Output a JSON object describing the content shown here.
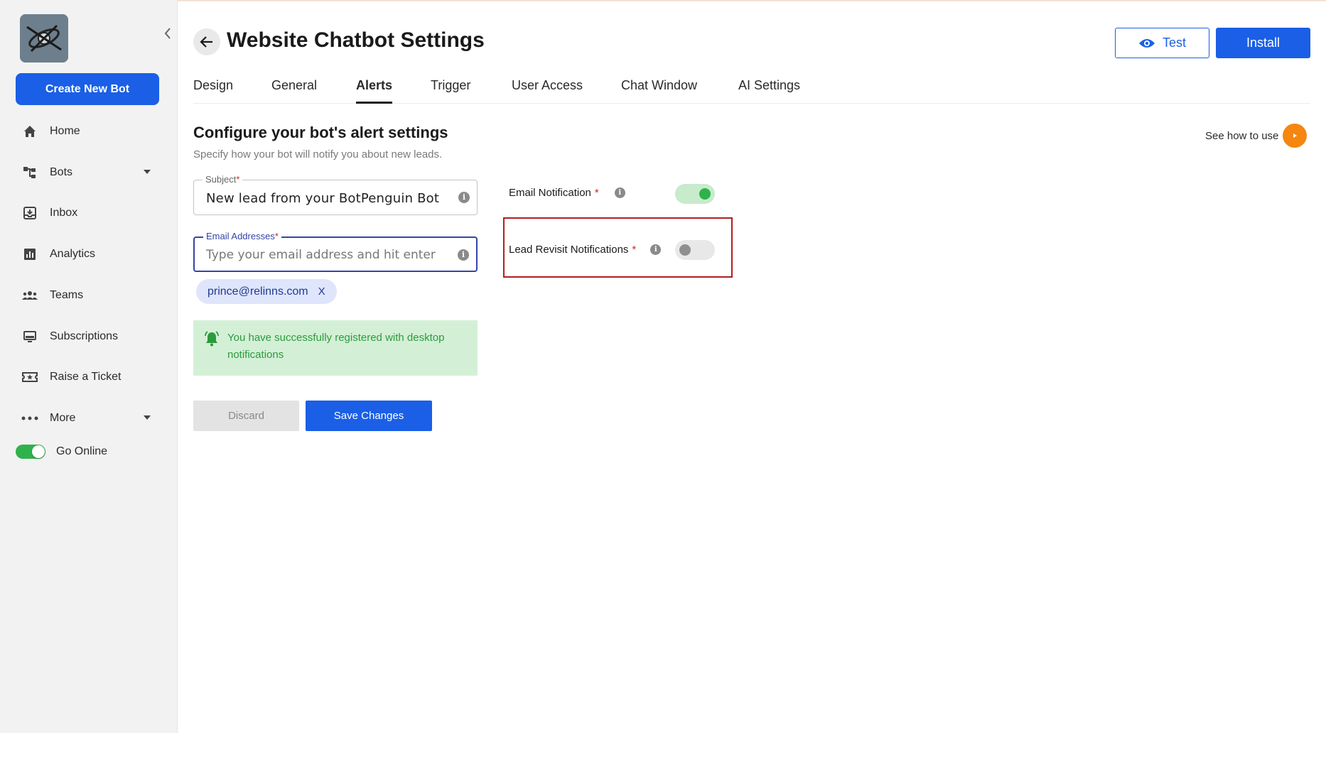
{
  "sidebar": {
    "create_label": "Create New Bot",
    "items": [
      {
        "label": "Home",
        "icon": "home-icon"
      },
      {
        "label": "Bots",
        "icon": "bots-icon",
        "has_caret": true
      },
      {
        "label": "Inbox",
        "icon": "inbox-icon"
      },
      {
        "label": "Analytics",
        "icon": "analytics-icon"
      },
      {
        "label": "Teams",
        "icon": "teams-icon"
      },
      {
        "label": "Subscriptions",
        "icon": "subscriptions-icon"
      },
      {
        "label": "Raise a Ticket",
        "icon": "ticket-icon"
      },
      {
        "label": "More",
        "icon": "more-icon",
        "has_caret": true
      }
    ],
    "go_online_label": "Go Online",
    "go_online_enabled": true
  },
  "header": {
    "title": "Website Chatbot Settings",
    "test_label": "Test",
    "install_label": "Install"
  },
  "tabs": [
    {
      "label": "Design",
      "active": false
    },
    {
      "label": "General",
      "active": false
    },
    {
      "label": "Alerts",
      "active": true
    },
    {
      "label": "Trigger",
      "active": false
    },
    {
      "label": "User Access",
      "active": false
    },
    {
      "label": "Chat Window",
      "active": false
    },
    {
      "label": "AI Settings",
      "active": false
    }
  ],
  "section": {
    "title": "Configure your bot's alert settings",
    "subtitle": "Specify how your bot will notify you about new leads.",
    "see_how_label": "See how to use"
  },
  "form": {
    "subject_label": "Subject",
    "subject_value": "New lead from your BotPenguin Bot",
    "email_label": "Email Addresses",
    "email_placeholder": "Type your email address and hit enter",
    "required_mark": "*",
    "email_chips": [
      {
        "text": "prince@relinns.com",
        "remove": "X"
      }
    ],
    "alert_message": "You have successfully registered with desktop notifications",
    "discard_label": "Discard",
    "save_label": "Save Changes"
  },
  "notifications": {
    "email_label": "Email Notification",
    "email_enabled": true,
    "lead_revisit_label": "Lead Revisit Notifications",
    "lead_revisit_enabled": false,
    "info_glyph": "i"
  },
  "colors": {
    "primary": "#1a5fe6",
    "success": "#2fb24c",
    "highlight": "#b21f1f",
    "accent_orange": "#f5860f"
  }
}
